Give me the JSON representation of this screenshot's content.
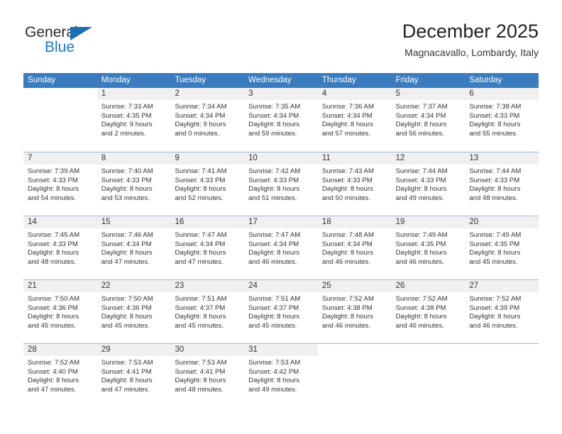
{
  "brand": {
    "name_part1": "General",
    "name_part2": "Blue",
    "color_primary": "#2077c6",
    "color_triangle": "#1a6fb5"
  },
  "header": {
    "title": "December 2025",
    "subtitle": "Magnacavallo, Lombardy, Italy"
  },
  "theme": {
    "header_bg": "#3a7cbe",
    "daynum_bg": "#f0f0f0",
    "row_divider": "#9bb8d4"
  },
  "calendar": {
    "weekday_headers": [
      "Sunday",
      "Monday",
      "Tuesday",
      "Wednesday",
      "Thursday",
      "Friday",
      "Saturday"
    ],
    "weeks": [
      [
        {
          "day": "",
          "empty": true,
          "sunrise": "",
          "sunset": "",
          "daylight_line1": "",
          "daylight_line2": ""
        },
        {
          "day": "1",
          "sunrise": "Sunrise: 7:33 AM",
          "sunset": "Sunset: 4:35 PM",
          "daylight_line1": "Daylight: 9 hours",
          "daylight_line2": "and 2 minutes."
        },
        {
          "day": "2",
          "sunrise": "Sunrise: 7:34 AM",
          "sunset": "Sunset: 4:34 PM",
          "daylight_line1": "Daylight: 9 hours",
          "daylight_line2": "and 0 minutes."
        },
        {
          "day": "3",
          "sunrise": "Sunrise: 7:35 AM",
          "sunset": "Sunset: 4:34 PM",
          "daylight_line1": "Daylight: 8 hours",
          "daylight_line2": "and 59 minutes."
        },
        {
          "day": "4",
          "sunrise": "Sunrise: 7:36 AM",
          "sunset": "Sunset: 4:34 PM",
          "daylight_line1": "Daylight: 8 hours",
          "daylight_line2": "and 57 minutes."
        },
        {
          "day": "5",
          "sunrise": "Sunrise: 7:37 AM",
          "sunset": "Sunset: 4:34 PM",
          "daylight_line1": "Daylight: 8 hours",
          "daylight_line2": "and 56 minutes."
        },
        {
          "day": "6",
          "sunrise": "Sunrise: 7:38 AM",
          "sunset": "Sunset: 4:33 PM",
          "daylight_line1": "Daylight: 8 hours",
          "daylight_line2": "and 55 minutes."
        }
      ],
      [
        {
          "day": "7",
          "sunrise": "Sunrise: 7:39 AM",
          "sunset": "Sunset: 4:33 PM",
          "daylight_line1": "Daylight: 8 hours",
          "daylight_line2": "and 54 minutes."
        },
        {
          "day": "8",
          "sunrise": "Sunrise: 7:40 AM",
          "sunset": "Sunset: 4:33 PM",
          "daylight_line1": "Daylight: 8 hours",
          "daylight_line2": "and 53 minutes."
        },
        {
          "day": "9",
          "sunrise": "Sunrise: 7:41 AM",
          "sunset": "Sunset: 4:33 PM",
          "daylight_line1": "Daylight: 8 hours",
          "daylight_line2": "and 52 minutes."
        },
        {
          "day": "10",
          "sunrise": "Sunrise: 7:42 AM",
          "sunset": "Sunset: 4:33 PM",
          "daylight_line1": "Daylight: 8 hours",
          "daylight_line2": "and 51 minutes."
        },
        {
          "day": "11",
          "sunrise": "Sunrise: 7:43 AM",
          "sunset": "Sunset: 4:33 PM",
          "daylight_line1": "Daylight: 8 hours",
          "daylight_line2": "and 50 minutes."
        },
        {
          "day": "12",
          "sunrise": "Sunrise: 7:44 AM",
          "sunset": "Sunset: 4:33 PM",
          "daylight_line1": "Daylight: 8 hours",
          "daylight_line2": "and 49 minutes."
        },
        {
          "day": "13",
          "sunrise": "Sunrise: 7:44 AM",
          "sunset": "Sunset: 4:33 PM",
          "daylight_line1": "Daylight: 8 hours",
          "daylight_line2": "and 48 minutes."
        }
      ],
      [
        {
          "day": "14",
          "sunrise": "Sunrise: 7:45 AM",
          "sunset": "Sunset: 4:33 PM",
          "daylight_line1": "Daylight: 8 hours",
          "daylight_line2": "and 48 minutes."
        },
        {
          "day": "15",
          "sunrise": "Sunrise: 7:46 AM",
          "sunset": "Sunset: 4:34 PM",
          "daylight_line1": "Daylight: 8 hours",
          "daylight_line2": "and 47 minutes."
        },
        {
          "day": "16",
          "sunrise": "Sunrise: 7:47 AM",
          "sunset": "Sunset: 4:34 PM",
          "daylight_line1": "Daylight: 8 hours",
          "daylight_line2": "and 47 minutes."
        },
        {
          "day": "17",
          "sunrise": "Sunrise: 7:47 AM",
          "sunset": "Sunset: 4:34 PM",
          "daylight_line1": "Daylight: 8 hours",
          "daylight_line2": "and 46 minutes."
        },
        {
          "day": "18",
          "sunrise": "Sunrise: 7:48 AM",
          "sunset": "Sunset: 4:34 PM",
          "daylight_line1": "Daylight: 8 hours",
          "daylight_line2": "and 46 minutes."
        },
        {
          "day": "19",
          "sunrise": "Sunrise: 7:49 AM",
          "sunset": "Sunset: 4:35 PM",
          "daylight_line1": "Daylight: 8 hours",
          "daylight_line2": "and 46 minutes."
        },
        {
          "day": "20",
          "sunrise": "Sunrise: 7:49 AM",
          "sunset": "Sunset: 4:35 PM",
          "daylight_line1": "Daylight: 8 hours",
          "daylight_line2": "and 45 minutes."
        }
      ],
      [
        {
          "day": "21",
          "sunrise": "Sunrise: 7:50 AM",
          "sunset": "Sunset: 4:36 PM",
          "daylight_line1": "Daylight: 8 hours",
          "daylight_line2": "and 45 minutes."
        },
        {
          "day": "22",
          "sunrise": "Sunrise: 7:50 AM",
          "sunset": "Sunset: 4:36 PM",
          "daylight_line1": "Daylight: 8 hours",
          "daylight_line2": "and 45 minutes."
        },
        {
          "day": "23",
          "sunrise": "Sunrise: 7:51 AM",
          "sunset": "Sunset: 4:37 PM",
          "daylight_line1": "Daylight: 8 hours",
          "daylight_line2": "and 45 minutes."
        },
        {
          "day": "24",
          "sunrise": "Sunrise: 7:51 AM",
          "sunset": "Sunset: 4:37 PM",
          "daylight_line1": "Daylight: 8 hours",
          "daylight_line2": "and 45 minutes."
        },
        {
          "day": "25",
          "sunrise": "Sunrise: 7:52 AM",
          "sunset": "Sunset: 4:38 PM",
          "daylight_line1": "Daylight: 8 hours",
          "daylight_line2": "and 46 minutes."
        },
        {
          "day": "26",
          "sunrise": "Sunrise: 7:52 AM",
          "sunset": "Sunset: 4:38 PM",
          "daylight_line1": "Daylight: 8 hours",
          "daylight_line2": "and 46 minutes."
        },
        {
          "day": "27",
          "sunrise": "Sunrise: 7:52 AM",
          "sunset": "Sunset: 4:39 PM",
          "daylight_line1": "Daylight: 8 hours",
          "daylight_line2": "and 46 minutes."
        }
      ],
      [
        {
          "day": "28",
          "sunrise": "Sunrise: 7:52 AM",
          "sunset": "Sunset: 4:40 PM",
          "daylight_line1": "Daylight: 8 hours",
          "daylight_line2": "and 47 minutes."
        },
        {
          "day": "29",
          "sunrise": "Sunrise: 7:53 AM",
          "sunset": "Sunset: 4:41 PM",
          "daylight_line1": "Daylight: 8 hours",
          "daylight_line2": "and 47 minutes."
        },
        {
          "day": "30",
          "sunrise": "Sunrise: 7:53 AM",
          "sunset": "Sunset: 4:41 PM",
          "daylight_line1": "Daylight: 8 hours",
          "daylight_line2": "and 48 minutes."
        },
        {
          "day": "31",
          "sunrise": "Sunrise: 7:53 AM",
          "sunset": "Sunset: 4:42 PM",
          "daylight_line1": "Daylight: 8 hours",
          "daylight_line2": "and 49 minutes."
        },
        {
          "day": "",
          "empty": true,
          "sunrise": "",
          "sunset": "",
          "daylight_line1": "",
          "daylight_line2": ""
        },
        {
          "day": "",
          "empty": true,
          "sunrise": "",
          "sunset": "",
          "daylight_line1": "",
          "daylight_line2": ""
        },
        {
          "day": "",
          "empty": true,
          "sunrise": "",
          "sunset": "",
          "daylight_line1": "",
          "daylight_line2": ""
        }
      ]
    ]
  }
}
